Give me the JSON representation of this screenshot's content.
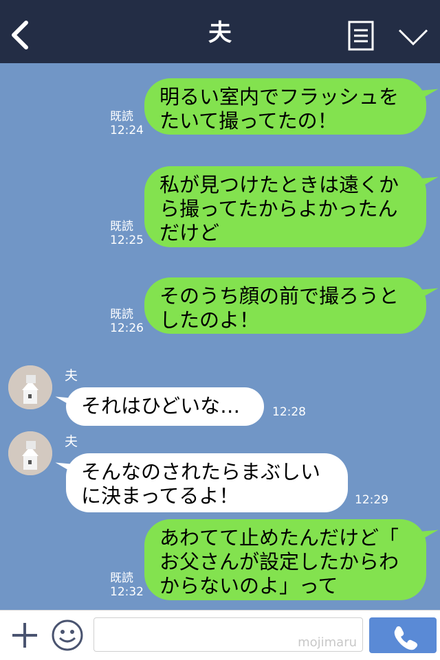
{
  "header": {
    "title": "夫"
  },
  "messages": [
    {
      "line1": "明るい室内でフラッシュを",
      "line2": "たいて撮ってたの！",
      "read": "既読",
      "time": "12:24"
    },
    {
      "line1": "私が見つけたときは遠くか",
      "line2": "ら撮ってたからよかったん",
      "line3": "だけど",
      "read": "既読",
      "time": "12:25"
    },
    {
      "line1": "そのうち顔の前で撮ろうと",
      "line2": "したのよ！",
      "read": "既読",
      "time": "12:26"
    },
    {
      "sender": "夫",
      "line1": "それはひどいな…",
      "time": "12:28"
    },
    {
      "sender": "夫",
      "line1": "そんなのされたらまぶしい",
      "line2": "に決まってるよ！",
      "time": "12:29"
    },
    {
      "line1": "あわてて止めたんだけど「",
      "line2": "お父さんが設定したからわ",
      "line3": "からないのよ」って",
      "read": "既読",
      "time": "12:32"
    }
  ],
  "footer": {
    "watermark": "mojimaru"
  },
  "colors": {
    "header": "#232d45",
    "chat_bg": "#7196c6",
    "outgoing": "#83e24f",
    "incoming": "#ffffff",
    "call": "#5a8ad6"
  }
}
